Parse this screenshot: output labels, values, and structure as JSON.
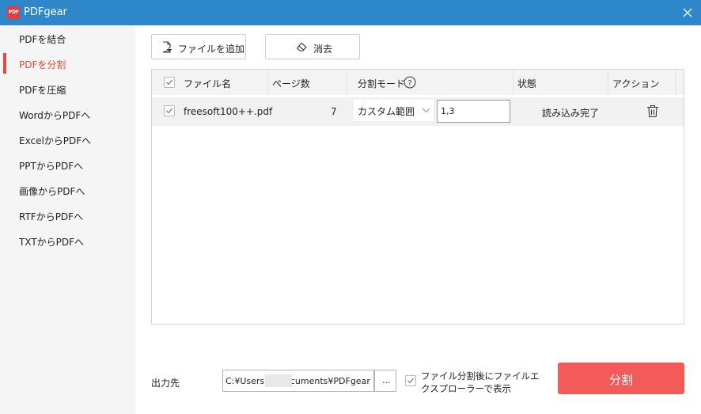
{
  "window": {
    "title": "PDFgear",
    "logo_text": "PDF"
  },
  "sidebar": {
    "items": [
      {
        "label": "PDFを結合"
      },
      {
        "label": "PDFを分割"
      },
      {
        "label": "PDFを圧縮"
      },
      {
        "label": "WordからPDFへ"
      },
      {
        "label": "ExcelからPDFへ"
      },
      {
        "label": "PPTからPDFへ"
      },
      {
        "label": "画像からPDFへ"
      },
      {
        "label": "RTFからPDFへ"
      },
      {
        "label": "TXTからPDFへ"
      }
    ],
    "active_index": 1
  },
  "toolbar": {
    "add_file_label": "ファイルを追加",
    "clear_label": "消去"
  },
  "table": {
    "headers": {
      "file_name": "ファイル名",
      "pages": "ページ数",
      "split_mode": "分割モード",
      "status": "状態",
      "action": "アクション"
    },
    "help_icon": "?",
    "rows": [
      {
        "checked": true,
        "file_name": "freesoft100++.pdf",
        "pages": "7",
        "split_mode": "カスタム範囲",
        "range": "1,3",
        "status": "読み込み完了",
        "action_icon": "trash-icon"
      }
    ]
  },
  "output": {
    "label": "出力先",
    "path": "C:¥Users¥          ¥Documents¥PDFgear",
    "browse_label": "...",
    "open_explorer_label": "ファイル分割後にファイルエクスプローラーで表示",
    "open_explorer_checked": true
  },
  "split_button": {
    "label": "分割"
  },
  "colors": {
    "titlebar": "#2d87c8",
    "accent": "#e04a3f",
    "split_button": "#f25b58"
  }
}
